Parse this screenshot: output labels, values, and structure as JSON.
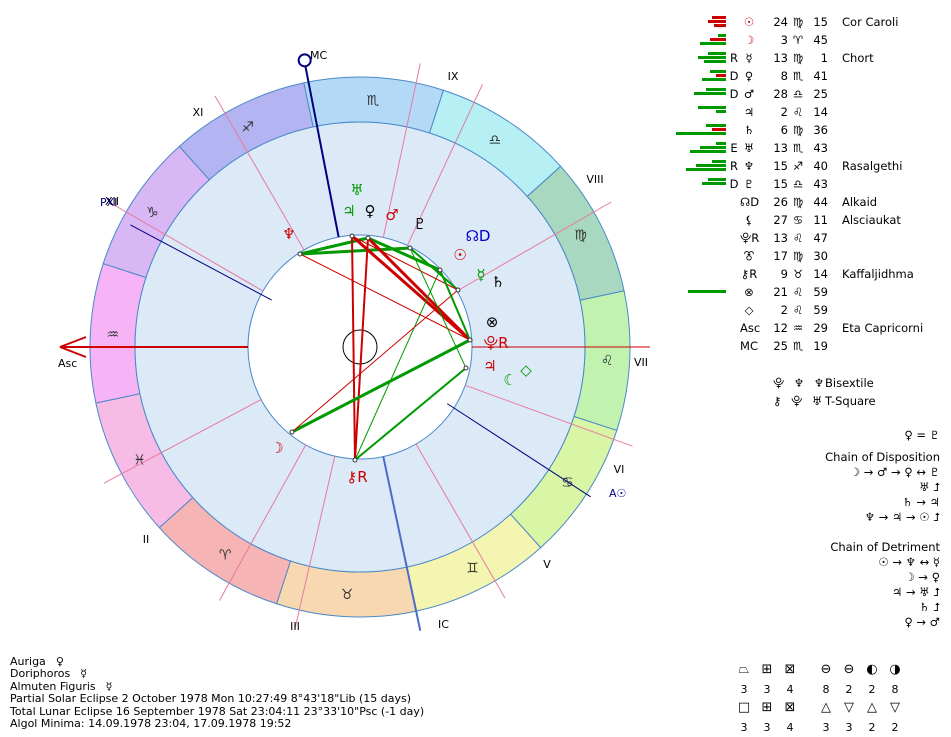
{
  "chart": {
    "angles": [
      {
        "label": "MC"
      },
      {
        "label": "Asc"
      },
      {
        "label": "IC"
      }
    ],
    "house_labels": [
      "II",
      "III",
      "V",
      "VI",
      "VII",
      "VIII",
      "IX",
      "XI",
      "XII"
    ],
    "sign_ring": [
      {
        "glyph": "♒",
        "color": "#f6b3f6"
      },
      {
        "glyph": "♑",
        "color": "#d8b7f4"
      },
      {
        "glyph": "♐",
        "color": "#b4b4f2"
      },
      {
        "glyph": "♏",
        "color": "#b3d9f7"
      },
      {
        "glyph": "♎",
        "color": "#b6f0f4"
      },
      {
        "glyph": "♍",
        "color": "#a8d8c0"
      },
      {
        "glyph": "♌",
        "color": "#c2f2b0"
      },
      {
        "glyph": "♋",
        "color": "#d9f5a6"
      },
      {
        "glyph": "♊",
        "color": "#f3f5b0"
      },
      {
        "glyph": "♉",
        "color": "#f8d8b0"
      },
      {
        "glyph": "♈",
        "color": "#f6b4b4"
      },
      {
        "glyph": "♓",
        "color": "#f7bce6"
      }
    ],
    "planet_glyphs": [
      {
        "glyph": "♅",
        "color": "#009900"
      },
      {
        "glyph": "♃",
        "color": "#009900"
      },
      {
        "glyph": "♀",
        "color": "#000000"
      },
      {
        "glyph": "♂",
        "color": "#cc0000"
      },
      {
        "glyph": "♇",
        "color": "#000000"
      },
      {
        "glyph": "♆",
        "color": "#cc0000"
      },
      {
        "glyph": "☊D",
        "color": "#0000cc"
      },
      {
        "glyph": "☉",
        "color": "#cc0000"
      },
      {
        "glyph": "☿",
        "color": "#009900"
      },
      {
        "glyph": "♄",
        "color": "#000000"
      },
      {
        "glyph": "⊗",
        "color": "#000000"
      },
      {
        "glyph": "⯓R",
        "color": "#cc0000"
      },
      {
        "glyph": "♃",
        "color": "#cc0000"
      },
      {
        "glyph": "☾",
        "color": "#009900"
      },
      {
        "glyph": "◇",
        "color": "#009900"
      },
      {
        "glyph": "☽",
        "color": "#cc0000"
      },
      {
        "glyph": "⚷R",
        "color": "#cc0000"
      }
    ],
    "extra_points": [
      {
        "label": "PXI"
      },
      {
        "label": "A☉"
      }
    ]
  },
  "planets": [
    {
      "flag": "",
      "symbol": "☉",
      "sym_color": "#cc0000",
      "deg": "24",
      "sign": "♍",
      "min": "15",
      "star": "Cor Caroli",
      "bars": [
        {
          "w": 14,
          "c": "#cc0000"
        },
        {
          "w": 18,
          "c": "#cc0000"
        },
        {
          "w": 12,
          "c": "#cc0000"
        }
      ]
    },
    {
      "flag": "",
      "symbol": "☽",
      "sym_color": "#cc0000",
      "deg": "3",
      "sign": "♈",
      "min": "45",
      "star": "",
      "bars": [
        {
          "w": 8,
          "c": "#009900"
        },
        {
          "w": 16,
          "c": "#cc0000"
        },
        {
          "w": 26,
          "c": "#009900"
        }
      ]
    },
    {
      "flag": "R",
      "symbol": "☿",
      "sym_color": "#000000",
      "deg": "13",
      "sign": "♍",
      "min": "1",
      "star": "Chort",
      "bars": [
        {
          "w": 18,
          "c": "#009900"
        },
        {
          "w": 28,
          "c": "#009900"
        },
        {
          "w": 22,
          "c": "#009900"
        }
      ]
    },
    {
      "flag": "D",
      "symbol": "♀",
      "sym_color": "#000000",
      "deg": "8",
      "sign": "♏",
      "min": "41",
      "star": "",
      "bars": [
        {
          "w": 16,
          "c": "#009900"
        },
        {
          "w": 10,
          "c": "#cc0000"
        },
        {
          "w": 24,
          "c": "#009900"
        }
      ]
    },
    {
      "flag": "D",
      "symbol": "♂",
      "sym_color": "#000000",
      "deg": "28",
      "sign": "♎",
      "min": "25",
      "star": "",
      "bars": [
        {
          "w": 20,
          "c": "#009900"
        },
        {
          "w": 32,
          "c": "#009900"
        },
        {
          "w": 0,
          "c": "#009900"
        }
      ]
    },
    {
      "flag": "",
      "symbol": "♃",
      "sym_color": "#000000",
      "deg": "2",
      "sign": "♌",
      "min": "14",
      "star": "",
      "bars": [
        {
          "w": 28,
          "c": "#009900"
        },
        {
          "w": 10,
          "c": "#009900"
        },
        {
          "w": 0,
          "c": "#009900"
        }
      ]
    },
    {
      "flag": "",
      "symbol": "♄",
      "sym_color": "#000000",
      "deg": "6",
      "sign": "♍",
      "min": "36",
      "star": "",
      "bars": [
        {
          "w": 20,
          "c": "#009900"
        },
        {
          "w": 14,
          "c": "#cc0000"
        },
        {
          "w": 50,
          "c": "#009900"
        }
      ]
    },
    {
      "flag": "E",
      "symbol": "♅",
      "sym_color": "#000000",
      "deg": "13",
      "sign": "♏",
      "min": "43",
      "star": "",
      "bars": [
        {
          "w": 10,
          "c": "#009900"
        },
        {
          "w": 26,
          "c": "#009900"
        },
        {
          "w": 36,
          "c": "#009900"
        }
      ]
    },
    {
      "flag": "R",
      "symbol": "♆",
      "sym_color": "#000000",
      "deg": "15",
      "sign": "♐",
      "min": "40",
      "star": "Rasalgethi",
      "bars": [
        {
          "w": 14,
          "c": "#009900"
        },
        {
          "w": 30,
          "c": "#009900"
        },
        {
          "w": 40,
          "c": "#009900"
        }
      ]
    },
    {
      "flag": "D",
      "symbol": "♇",
      "sym_color": "#000000",
      "deg": "15",
      "sign": "♎",
      "min": "43",
      "star": "",
      "bars": [
        {
          "w": 18,
          "c": "#009900"
        },
        {
          "w": 24,
          "c": "#009900"
        },
        {
          "w": 0,
          "c": "#009900"
        }
      ]
    },
    {
      "flag": "",
      "symbol": "☊D",
      "sym_color": "#000000",
      "deg": "26",
      "sign": "♍",
      "min": "44",
      "star": "Alkaid",
      "bars": []
    },
    {
      "flag": "",
      "symbol": "⚸",
      "sym_color": "#000000",
      "deg": "27",
      "sign": "♋",
      "min": "11",
      "star": "Alsciaukat",
      "bars": []
    },
    {
      "flag": "",
      "symbol": "⯓R",
      "sym_color": "#000000",
      "deg": "13",
      "sign": "♌",
      "min": "47",
      "star": "",
      "bars": []
    },
    {
      "flag": "",
      "symbol": "⯔",
      "sym_color": "#000000",
      "deg": "17",
      "sign": "♍",
      "min": "30",
      "star": "",
      "bars": []
    },
    {
      "flag": "",
      "symbol": "⚷R",
      "sym_color": "#000000",
      "deg": "9",
      "sign": "♉",
      "min": "14",
      "star": "Kaffaljidhma",
      "bars": []
    },
    {
      "flag": "",
      "symbol": "⊗",
      "sym_color": "#000000",
      "deg": "21",
      "sign": "♌",
      "min": "59",
      "star": "",
      "bars": [
        {
          "w": 0,
          "c": "#009900"
        },
        {
          "w": 38,
          "c": "#009900"
        },
        {
          "w": 0,
          "c": "#009900"
        }
      ]
    },
    {
      "flag": "",
      "symbol": "◇",
      "sym_color": "#000000",
      "deg": "2",
      "sign": "♌",
      "min": "59",
      "star": "",
      "bars": []
    },
    {
      "flag": "",
      "symbol": "Asc",
      "sym_color": "#000000",
      "deg": "12",
      "sign": "♒",
      "min": "29",
      "star": "Eta Capricorni",
      "bars": []
    },
    {
      "flag": "",
      "symbol": "MC",
      "sym_color": "#000000",
      "deg": "25",
      "sign": "♏",
      "min": "19",
      "star": "",
      "bars": []
    }
  ],
  "configurations": [
    {
      "glyphs": "⯓ ♆ ♆",
      "name": "Bisextile"
    },
    {
      "glyphs": "⚷ ⯓ ♅",
      "name": "T-Square"
    }
  ],
  "chains": {
    "equal": "♀ = ♇",
    "disposition_title": "Chain of Disposition",
    "disposition_lines": [
      "☽ → ♂ → ♀ ↔ ♇",
      "♅ ⮥",
      "♄ → ♃",
      "♆ → ♃ → ☉ ⮥"
    ],
    "detriment_title": "Chain of Detriment",
    "detriment_lines": [
      "☉ → ♆ ↔ ☿",
      "☽ → ♀",
      "♃ → ♅ ⮥",
      "♄ ⮥",
      "♀ → ♂"
    ]
  },
  "info": {
    "auriga_label": "Auriga",
    "auriga_glyph": "♀",
    "doriphoros_label": "Doriphoros",
    "doriphoros_glyph": "☿",
    "almuten_label": "Almuten Figuris",
    "almuten_glyph": "☿",
    "solar_eclipse": "Partial Solar Eclipse 2 October 1978 Mon 10:27:49  8°43'18\"Lib (15 days)",
    "lunar_eclipse": "Total Lunar Eclipse 16 September 1978 Sat 23:04:11 23°33'10\"Psc (-1 day)",
    "algol": "Algol Minima: 14.09.1978 23:04,  17.09.1978 19:52"
  },
  "stats": [
    {
      "glyph": "⏢",
      "value": "3"
    },
    {
      "glyph": "⊞",
      "value": "3"
    },
    {
      "glyph": "⊠",
      "value": "4"
    },
    {
      "glyph": "⊖",
      "value": "8"
    },
    {
      "glyph": "⊖",
      "value": "2"
    },
    {
      "glyph": "◐",
      "value": "2"
    },
    {
      "glyph": "◑",
      "value": "8"
    },
    {
      "glyph": "□",
      "value": "3"
    },
    {
      "glyph": "⊞",
      "value": "3"
    },
    {
      "glyph": "⊠",
      "value": "4"
    },
    {
      "glyph": "△",
      "value": "3"
    },
    {
      "glyph": "▽",
      "value": "3"
    },
    {
      "glyph": "△",
      "value": "2"
    },
    {
      "glyph": "▽",
      "value": "2"
    }
  ]
}
